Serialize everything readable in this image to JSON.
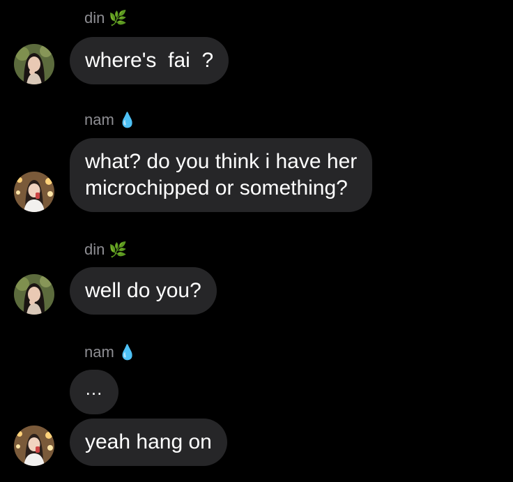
{
  "messages": [
    {
      "sender": "din",
      "sender_emoji": "🌿",
      "text": "where's  fai  ?"
    },
    {
      "sender": "nam",
      "sender_emoji": "💧",
      "text_line1": "what? do you think i have her",
      "text_line2": "microchipped or something?"
    },
    {
      "sender": "din",
      "sender_emoji": "🌿",
      "text": "well do you?"
    },
    {
      "sender": "nam",
      "sender_emoji": "💧",
      "typing": "...",
      "text": "yeah hang on"
    }
  ],
  "colors": {
    "background": "#000000",
    "bubble": "#262628",
    "sender_name": "#8e8e93",
    "text": "#ffffff",
    "leaf_emoji": "#4caf50",
    "droplet_emoji": "#4fc3f7"
  },
  "icons": {
    "din_avatar": "avatar-din",
    "nam_avatar": "avatar-nam",
    "leaf": "leaf-icon",
    "droplet": "droplet-icon"
  }
}
